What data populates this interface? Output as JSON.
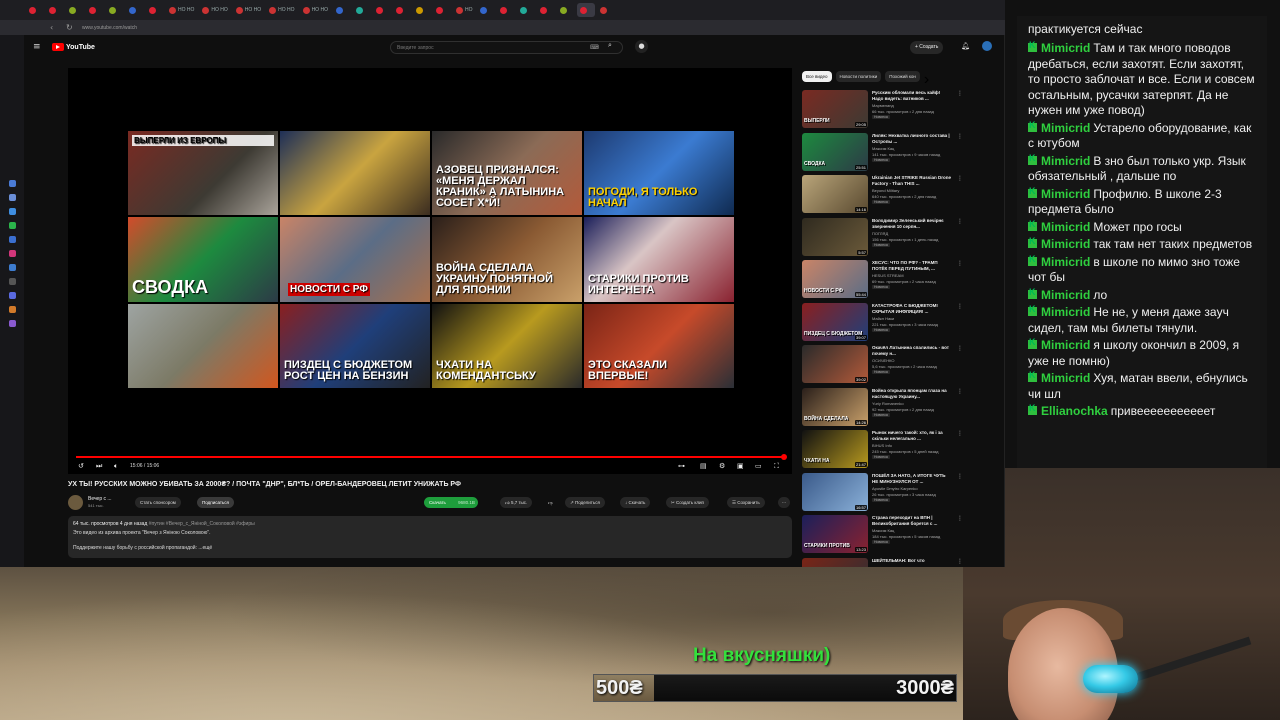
{
  "browser": {
    "url": "www.youtube.com/watch",
    "tabs": [
      {
        "label": "",
        "color": "#d23"
      },
      {
        "label": "",
        "color": "#d23"
      },
      {
        "label": "",
        "color": "#8a2"
      },
      {
        "label": "",
        "color": "#d23"
      },
      {
        "label": "",
        "color": "#8a2"
      },
      {
        "label": "",
        "color": "#36c"
      },
      {
        "label": "",
        "color": "#d23"
      },
      {
        "label": "НО НО",
        "color": "#c33"
      },
      {
        "label": "НО НО",
        "color": "#c33"
      },
      {
        "label": "НО НО",
        "color": "#c33"
      },
      {
        "label": "НО НО",
        "color": "#c33"
      },
      {
        "label": "НО НО",
        "color": "#c33"
      },
      {
        "label": "",
        "color": "#36c"
      },
      {
        "label": "",
        "color": "#2a9"
      },
      {
        "label": "",
        "color": "#d23"
      },
      {
        "label": "",
        "color": "#d23"
      },
      {
        "label": "",
        "color": "#c90"
      },
      {
        "label": "",
        "color": "#d23"
      },
      {
        "label": "НО",
        "color": "#c33"
      },
      {
        "label": "",
        "color": "#36c"
      },
      {
        "label": "",
        "color": "#d23"
      },
      {
        "label": "",
        "color": "#2a9"
      },
      {
        "label": "",
        "color": "#d23"
      },
      {
        "label": "",
        "color": "#8a2"
      },
      {
        "label": "",
        "color": "#d23"
      },
      {
        "label": "",
        "color": "#c33"
      }
    ]
  },
  "youtube": {
    "logo_text": "YouTube",
    "search_placeholder": "Введите запрос",
    "create_label": "+ Создать"
  },
  "video": {
    "time": "15:06 / 15:06",
    "progress_fraction": 1.0,
    "title": "УХ ТЫ! РУССКИХ МОЖНО УБИВАТЬ ЗА 2000₴? / ПОЧТА \"ДНР\", БЛ*ТЬ / ОРЁЛ-БАНДЕРОВЕЦ ЛЕТИТ УНИЖАТЬ РФ",
    "channel_name": "Вечер с ...",
    "channel_subs": "541 тыс.",
    "join_label": "Стать спонсором",
    "subscribe_label": "Подписаться",
    "download_label": "Скачать",
    "download_count": "9680.1B",
    "like_count": "5,7 тыс.",
    "share_label": "Поделиться",
    "save_download_label": "Скачать",
    "clip_label": "Создать клип",
    "saveto_label": "Сохранить",
    "description": {
      "stats": "64 тыс. просмотров  4 дня назад",
      "tags": "  #путин #Вечер_с_Янiной_Соколовой #эфиры",
      "line1": "Это видео из архива проекта \"Вечер з Яніною Соколовою\".",
      "line2": "Поддержите нашу борьбу с российской пропагандой:  ...ещё"
    },
    "grid": [
      {
        "text": "ВЫПЕРЛИ ИЗ ЕВРОПЫ",
        "style": "top",
        "bg": "linear-gradient(135deg,#7a2a22,#3d3a33 60%,#a9a39a)"
      },
      {
        "text": "",
        "style": "",
        "bg": "linear-gradient(135deg,#1e2f57,#c9a440 50%,#3b2d20)"
      },
      {
        "text": "АЗОВЕЦ ПРИЗНАЛСЯ: «МЕНЯ ДЕРЖАЛ КРАНИК» А ЛАТЫНИНА СОСЕТ Х*Й!",
        "style": "mid",
        "bg": "linear-gradient(135deg,#2a2a2a,#8b6b56 50%,#b35a3a)"
      },
      {
        "text": "ПОГОДИ, Я ТОЛЬКО НАЧАЛ",
        "style": "mid yellow",
        "bg": "linear-gradient(135deg,#1d3a70,#3b7bd1 50%,#0f2a50)"
      },
      {
        "text": "СВОДКА",
        "style": "big",
        "bg": "linear-gradient(135deg,#d34b2b,#1d8a3f 50%,#2c3a46)"
      },
      {
        "text": "НОВОСТИ С РФ",
        "style": "box",
        "bg": "linear-gradient(135deg,#c98467,#5b6d86 50%,#a8704d)"
      },
      {
        "text": "ВОЙНА СДЕЛАЛА УКРАИНУ ПОНЯТНОЙ ДЛЯ ЯПОНИИ",
        "style": "mid",
        "bg": "linear-gradient(135deg,#2a1f1a,#8a5a33 50%,#c9a06a)"
      },
      {
        "text": "Старики против интернета",
        "style": "mid",
        "bg": "linear-gradient(135deg,#1b1f5a,#d9c5c5 40%,#8a2230)"
      },
      {
        "text": "",
        "style": "",
        "bg": "linear-gradient(135deg,#9ea4a2,#7c7a66 50%,#d1571f)"
      },
      {
        "text": "ПИЗДЕЦ С БЮДЖЕТОМ РОСТ ЦЕН НА БЕНЗИН",
        "style": "mid",
        "bg": "linear-gradient(135deg,#8a1f1f,#1f3f7a 50%,#222)"
      },
      {
        "text": "ЧХАТИ НА КОМЕНДАНТСЬКУ",
        "style": "mid",
        "bg": "linear-gradient(135deg,#111,#b89a1f 50%,#2a2a2a)"
      },
      {
        "text": "ЭТО СКАЗАЛИ ВПЕРВЫЕ!",
        "style": "mid",
        "bg": "linear-gradient(135deg,#7a2416,#c74a2a 50%,#2a2f36)"
      }
    ]
  },
  "recommendations": {
    "chips": [
      "Все видео",
      "Новости политики",
      "Похожий кон"
    ],
    "items": [
      {
        "title": "Русским обломали весь кайф! Надо видеть: ватников ...",
        "channel": "Мармеланд",
        "meta": "66 тыс. просмотров • 2 дня назад",
        "duration": "29:05",
        "thumb_label": "ВЫПЕРЛИ",
        "bg": "linear-gradient(135deg,#7a2a22,#3d3a33)"
      },
      {
        "title": "Лиляк: Нехватка личного состава | Остропы ...",
        "channel": "Максим Кац",
        "meta": "141 тыс. просмотров • 9 часов назад",
        "duration": "25:51",
        "thumb_label": "СВОДКА",
        "bg": "linear-gradient(135deg,#1d8a3f,#2c3a46)"
      },
      {
        "title": "Ukrainian Jet STRIKE Russian Drone Factory - Than THIS ...",
        "channel": "Beyond Military",
        "meta": "640 тыс. просмотров • 2 дня назад",
        "duration": "14:16",
        "thumb_label": "",
        "bg": "linear-gradient(135deg,#b9a57a,#5a4a30)"
      },
      {
        "title": "Володимир Зеленський вечірнє звернення 10 серпн...",
        "channel": "ПОГЛЯД",
        "meta": "156 тыс. просмотров • 1 день назад",
        "duration": "5:57",
        "thumb_label": "",
        "bg": "linear-gradient(135deg,#2f2a1f,#6b5a3a)"
      },
      {
        "title": "ХЕСУС: ЧТО ПО РФ? - ТРАМП ПОТЁК ПЕРЕД ПУТИНЫМ, ...",
        "channel": "HESUS STREAM",
        "meta": "69 тыс. просмотров • 2 часа назад",
        "duration": "55:44",
        "thumb_label": "НОВОСТИ С РФ",
        "bg": "linear-gradient(135deg,#c98467,#5b6d86)"
      },
      {
        "title": "КАТАСТРОФА С БЮДЖЕТОМ! СКРЫТАЯ ИНФЛЯЦИЯ! ...",
        "channel": "Майкл Наки",
        "meta": "221 тыс. просмотров • 3 часа назад",
        "duration": "39:07",
        "thumb_label": "ПИЗДЕЦ С БЮДЖЕТОМ",
        "bg": "linear-gradient(135deg,#8a1f1f,#1f3f7a)"
      },
      {
        "title": "Окачёл Латынина спалились - вот почему н...",
        "channel": "ОСИЧЕНКО",
        "meta": "5,6 тыс. просмотров • 2 часа назад",
        "duration": "39:02",
        "thumb_label": "",
        "bg": "linear-gradient(135deg,#2a2a2a,#b35a3a)"
      },
      {
        "title": "Война открыла японцам глаза на настоящую Украину...",
        "channel": "Yuriy Romanenko",
        "meta": "92 тыс. просмотров • 2 дня назад",
        "duration": "14:26",
        "thumb_label": "ВОЙНА СДЕЛАЛА",
        "bg": "linear-gradient(135deg,#2a1f1a,#c9a06a)"
      },
      {
        "title": "Рынок ничего такой: хто, як і за скільки нелегально ...",
        "channel": "BIHUS Info",
        "meta": "245 тыс. просмотров • 5 дней назад",
        "duration": "21:47",
        "thumb_label": "ЧХАТИ НА",
        "bg": "linear-gradient(135deg,#111,#b89a1f)"
      },
      {
        "title": "ПОШЁЛ ЗА НАТО, А ИТОГЕ ЧУТЬ НЕ МИНУЗНУЛСЯ ОТ ...",
        "channel": "Apostle Dmytro Karpenko",
        "meta": "26 тыс. просмотров • 3 часа назад",
        "duration": "16:57",
        "thumb_label": "",
        "bg": "linear-gradient(135deg,#3a5a8a,#8ab0d8)"
      },
      {
        "title": "Страна переходит на ВПН | Великобритания борется с ...",
        "channel": "Максим Кац",
        "meta": "184 тыс. просмотров • 5 часов назад",
        "duration": "13:23",
        "thumb_label": "Старики против",
        "bg": "linear-gradient(135deg,#1b1f5a,#8a2230)"
      },
      {
        "title": "ШЕЙТЕЛЬМАН: Вот что",
        "channel": "",
        "meta": "",
        "duration": "",
        "thumb_label": "",
        "bg": "linear-gradient(135deg,#7a2416,#2a2f36)"
      }
    ]
  },
  "chat": {
    "first_line": "практикуется сейчас",
    "messages": [
      {
        "user": "Mimicrid",
        "text": "Там и так много поводов дребаться, если захотят. Если захотят, то просто заблочат и все. Если и совсем остальным, русачки затерпят. Да не нужен им уже повод)"
      },
      {
        "user": "Mimicrid",
        "text": "Устарело оборудование, как с ютубом"
      },
      {
        "user": "Mimicrid",
        "text": "В зно был только укр. Язык обязательный , дальше по"
      },
      {
        "user": "Mimicrid",
        "text": "Профилю. В школе 2-3 предмета было"
      },
      {
        "user": "Mimicrid",
        "text": "Может про госы"
      },
      {
        "user": "Mimicrid",
        "text": "так там нет таких предметов"
      },
      {
        "user": "Mimicrid",
        "text": "в школе по мимо зно тоже чот бы"
      },
      {
        "user": "Mimicrid",
        "text": "ло"
      },
      {
        "user": "Mimicrid",
        "text": "Не не, у меня даже заyч сидел, там мы билеты тянули."
      },
      {
        "user": "Mimicrid",
        "text": "я школу окончил в 2009, я уже не помню)"
      },
      {
        "user": "Mimicrid",
        "text": "Хуя, матан ввели, ебнулись чи шл"
      },
      {
        "user": "Ellianochka",
        "text": "привееееееееееет"
      }
    ]
  },
  "donation": {
    "title": "На вкусняшки)",
    "current": "500₴",
    "goal": "3000₴",
    "progress_fraction": 0.167
  }
}
